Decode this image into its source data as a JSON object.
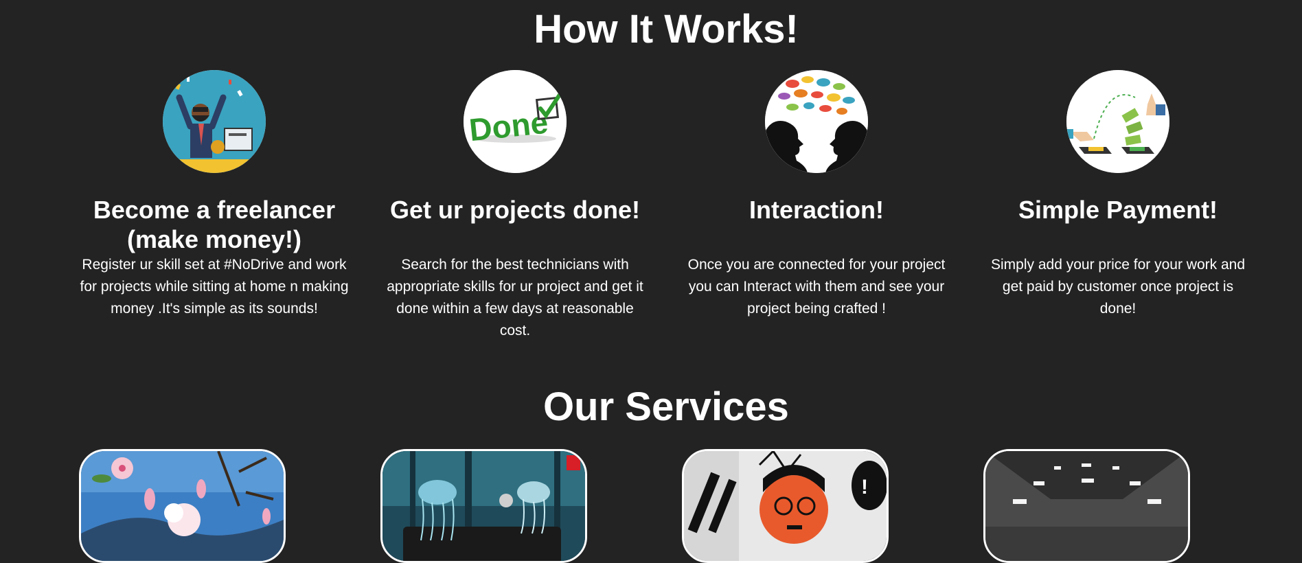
{
  "how_it_works": {
    "title": "How It Works!",
    "steps": [
      {
        "title_line1": "Become a freelancer",
        "title_line2": "(make money!)",
        "text": "Register ur skill set at #NoDrive and work for projects while sitting at home n making money .It's simple as its sounds!",
        "icon": "freelancer-celebrating-icon"
      },
      {
        "title_line1": "Get ur projects done!",
        "title_line2": "",
        "text": "Search for the best technicians with appropriate skills for ur project and get it done within a few days at reasonable cost.",
        "icon": "done-checkmark-icon",
        "icon_text": "Done"
      },
      {
        "title_line1": "Interaction!",
        "title_line2": "",
        "text": "Once you are connected for your project you can Interact with them and see your project being crafted !",
        "icon": "interaction-speech-bubbles-icon"
      },
      {
        "title_line1": "Simple Payment!",
        "title_line2": "",
        "text": "Simply add your price for your work and get paid by customer once project is done!",
        "icon": "payment-phone-money-icon"
      }
    ]
  },
  "services": {
    "title": "Our Services",
    "cards": [
      {
        "image": "flower-painting-image"
      },
      {
        "image": "jellyfish-design-image"
      },
      {
        "image": "comic-art-image"
      },
      {
        "image": "photography-image"
      }
    ]
  },
  "colors": {
    "background": "#232323",
    "text": "#ffffff",
    "accent_green": "#2f9e2f"
  }
}
